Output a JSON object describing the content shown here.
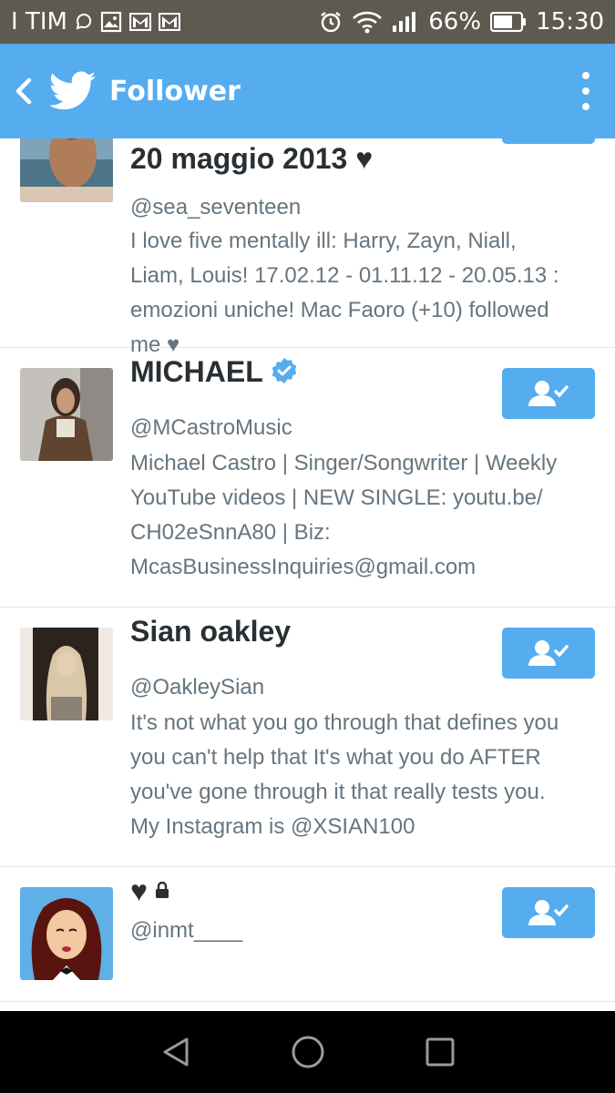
{
  "status_bar": {
    "carrier": "I TIM",
    "battery": "66%",
    "time": "15:30"
  },
  "app_bar": {
    "title": "Follower",
    "back_icon": "back-chevron-icon",
    "logo_icon": "twitter-bird-icon",
    "menu_icon": "overflow-menu-icon"
  },
  "colors": {
    "brand": "#55acee",
    "status_bar": "#5e5a50",
    "name_text": "#292f33",
    "secondary_text": "#66757f",
    "verified": "#55acee",
    "divider": "#e1e8ed"
  },
  "followers": [
    {
      "name": "20 maggio 2013 ♥",
      "handle": "@sea_seventeen",
      "bio_lines": [
        "I love five mentally ill: Harry, Zayn, Niall,",
        "Liam, Louis! 17.02.12 - 01.11.12 - 20.05.13 :",
        "emozioni uniche! Mac Faoro (+10) followed",
        "me ♥"
      ],
      "verified": false,
      "protected": false
    },
    {
      "name": "MICHAEL",
      "handle": "@MCastroMusic",
      "bio_lines": [
        "Michael Castro | Singer/Songwriter | Weekly",
        "YouTube videos | NEW SINGLE: youtu.be/",
        "CH02eSnnA80 | Biz:",
        "McasBusinessInquiries@gmail.com"
      ],
      "verified": true,
      "protected": false
    },
    {
      "name": "Sian oakley",
      "handle": "@OakleySian",
      "bio_lines": [
        "It's not what you go through that defines you",
        "you can't help that It's what you do AFTER",
        "you've gone through it that really tests you.",
        "My Instagram is @XSIAN100"
      ],
      "verified": false,
      "protected": false
    },
    {
      "name": "♥",
      "handle": "@inmt____",
      "bio_lines": [],
      "verified": false,
      "protected": true
    }
  ],
  "nav_bar": {
    "back": "nav-back-icon",
    "home": "nav-home-icon",
    "recents": "nav-recents-icon"
  }
}
